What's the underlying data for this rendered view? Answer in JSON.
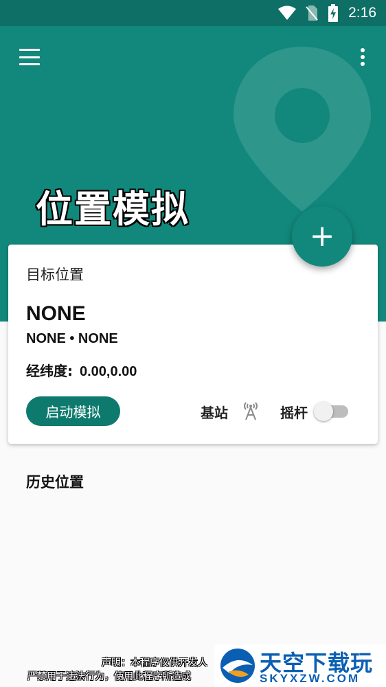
{
  "status_bar": {
    "time": "2:16"
  },
  "app_bar": {
    "title": "位置模拟",
    "menu_icon": "hamburger-menu-icon",
    "more_icon": "more-vert-icon"
  },
  "fab": {
    "label": "+",
    "icon": "add-icon"
  },
  "card": {
    "target_label": "目标位置",
    "location_name": "NONE",
    "location_sub": "NONE • NONE",
    "coords_label": "经纬度:",
    "coords_value": "0.00,0.00",
    "start_button": "启动模拟",
    "base_station_label": "基站",
    "base_station_icon": "cell-tower-icon",
    "joystick_label": "摇杆",
    "joystick_on": false
  },
  "history": {
    "title": "历史位置"
  },
  "disclaimer": {
    "line1": "声明：本程序仅供开发人",
    "line2": "严禁用于违法行为，使用此程序所造成"
  },
  "watermark": {
    "cn": "天空下载玩",
    "en": "SKYXZW.COM"
  },
  "colors": {
    "primary": "#12887c",
    "primary_dark": "#0e6f66",
    "button": "#0e7a6e",
    "background": "#fafafa"
  }
}
